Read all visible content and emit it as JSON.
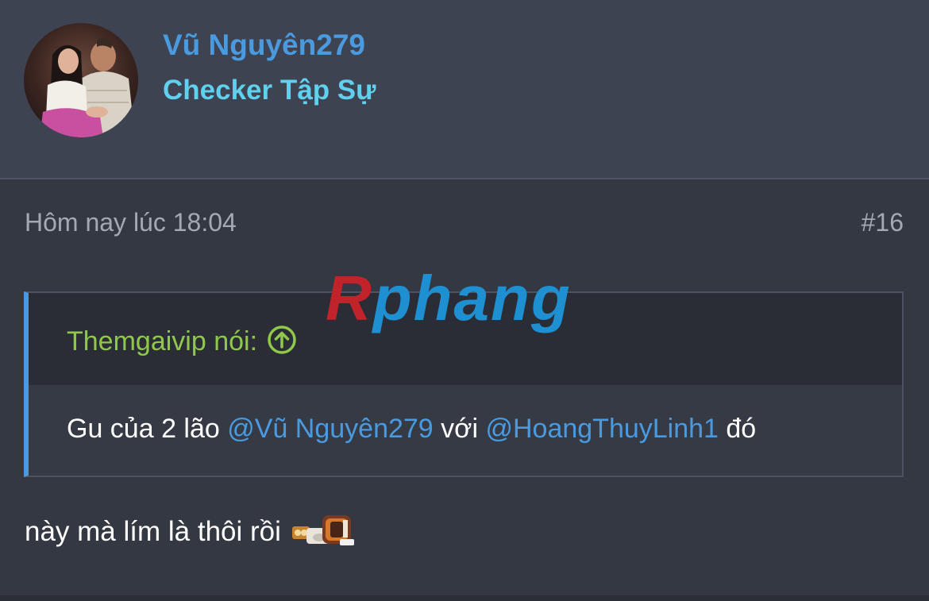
{
  "user": {
    "name": "Vũ Nguyên279",
    "title": "Checker Tập Sự"
  },
  "post": {
    "timestamp": "Hôm nay lúc 18:04",
    "number": "#16",
    "quote": {
      "author": "Themgaivip nói:",
      "text_before": "Gu của 2 lão ",
      "mention1": "@Vũ Nguyên279",
      "text_middle": " với ",
      "mention2": "@HoangThuyLinh1",
      "text_after": " đó"
    },
    "body": "này mà lím là thôi rồi"
  },
  "watermark": {
    "first": "R",
    "rest": "phang"
  },
  "icons": {
    "quote_arrow": "arrow-up-circle-icon",
    "sticker": "sticker-icon"
  },
  "colors": {
    "accent": "#4a9ae0",
    "user_title": "#5fd0ee",
    "quote_author": "#90c94a"
  }
}
